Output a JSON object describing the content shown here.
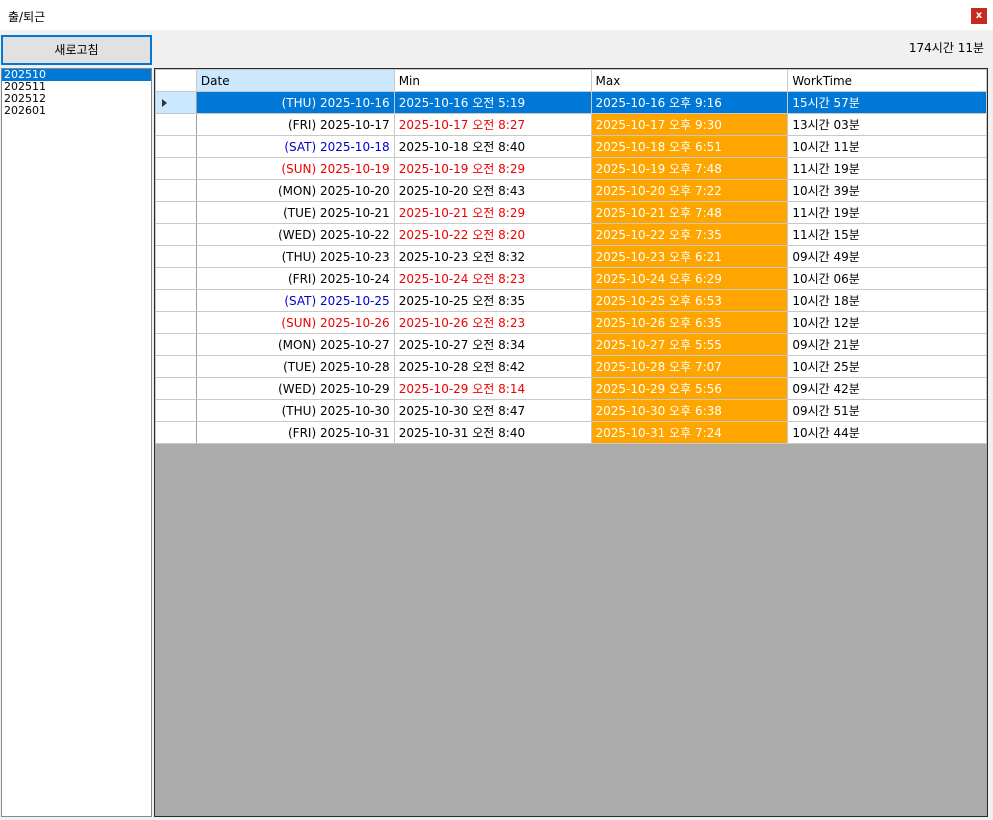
{
  "window": {
    "title": "출/퇴근",
    "close_label": "x"
  },
  "toolbar": {
    "refresh_label": "새로고침",
    "total_label": "174시간 11분"
  },
  "months": [
    "202510",
    "202511",
    "202512",
    "202601"
  ],
  "selected_month": "202510",
  "columns": [
    "Date",
    "Min",
    "Max",
    "WorkTime"
  ],
  "colors": {
    "selection": "#0078d7",
    "max_cell": "#ffa500",
    "late": "#e00000",
    "saturday": "#0000cc",
    "empty_area": "#ababab"
  },
  "rows": [
    {
      "date": "(THU) 2025-10-16",
      "min": "2025-10-16 오전 5:19",
      "max": "2025-10-16 오후 9:16",
      "work": "15시간 57분",
      "date_color": "",
      "min_color": "",
      "selected": true
    },
    {
      "date": "(FRI) 2025-10-17",
      "min": "2025-10-17 오전 8:27",
      "max": "2025-10-17 오후 9:30",
      "work": "13시간 03분",
      "date_color": "",
      "min_color": "red"
    },
    {
      "date": "(SAT) 2025-10-18",
      "min": "2025-10-18 오전 8:40",
      "max": "2025-10-18 오후 6:51",
      "work": "10시간 11분",
      "date_color": "blue",
      "min_color": ""
    },
    {
      "date": "(SUN) 2025-10-19",
      "min": "2025-10-19 오전 8:29",
      "max": "2025-10-19 오후 7:48",
      "work": "11시간 19분",
      "date_color": "red",
      "min_color": "red"
    },
    {
      "date": "(MON) 2025-10-20",
      "min": "2025-10-20 오전 8:43",
      "max": "2025-10-20 오후 7:22",
      "work": "10시간 39분",
      "date_color": "",
      "min_color": ""
    },
    {
      "date": "(TUE) 2025-10-21",
      "min": "2025-10-21 오전 8:29",
      "max": "2025-10-21 오후 7:48",
      "work": "11시간 19분",
      "date_color": "",
      "min_color": "red"
    },
    {
      "date": "(WED) 2025-10-22",
      "min": "2025-10-22 오전 8:20",
      "max": "2025-10-22 오후 7:35",
      "work": "11시간 15분",
      "date_color": "",
      "min_color": "red"
    },
    {
      "date": "(THU) 2025-10-23",
      "min": "2025-10-23 오전 8:32",
      "max": "2025-10-23 오후 6:21",
      "work": "09시간 49분",
      "date_color": "",
      "min_color": ""
    },
    {
      "date": "(FRI) 2025-10-24",
      "min": "2025-10-24 오전 8:23",
      "max": "2025-10-24 오후 6:29",
      "work": "10시간 06분",
      "date_color": "",
      "min_color": "red"
    },
    {
      "date": "(SAT) 2025-10-25",
      "min": "2025-10-25 오전 8:35",
      "max": "2025-10-25 오후 6:53",
      "work": "10시간 18분",
      "date_color": "blue",
      "min_color": ""
    },
    {
      "date": "(SUN) 2025-10-26",
      "min": "2025-10-26 오전 8:23",
      "max": "2025-10-26 오후 6:35",
      "work": "10시간 12분",
      "date_color": "red",
      "min_color": "red"
    },
    {
      "date": "(MON) 2025-10-27",
      "min": "2025-10-27 오전 8:34",
      "max": "2025-10-27 오후 5:55",
      "work": "09시간 21분",
      "date_color": "",
      "min_color": ""
    },
    {
      "date": "(TUE) 2025-10-28",
      "min": "2025-10-28 오전 8:42",
      "max": "2025-10-28 오후 7:07",
      "work": "10시간 25분",
      "date_color": "",
      "min_color": ""
    },
    {
      "date": "(WED) 2025-10-29",
      "min": "2025-10-29 오전 8:14",
      "max": "2025-10-29 오후 5:56",
      "work": "09시간 42분",
      "date_color": "",
      "min_color": "red"
    },
    {
      "date": "(THU) 2025-10-30",
      "min": "2025-10-30 오전 8:47",
      "max": "2025-10-30 오후 6:38",
      "work": "09시간 51분",
      "date_color": "",
      "min_color": ""
    },
    {
      "date": "(FRI) 2025-10-31",
      "min": "2025-10-31 오전 8:40",
      "max": "2025-10-31 오후 7:24",
      "work": "10시간 44분",
      "date_color": "",
      "min_color": ""
    }
  ]
}
